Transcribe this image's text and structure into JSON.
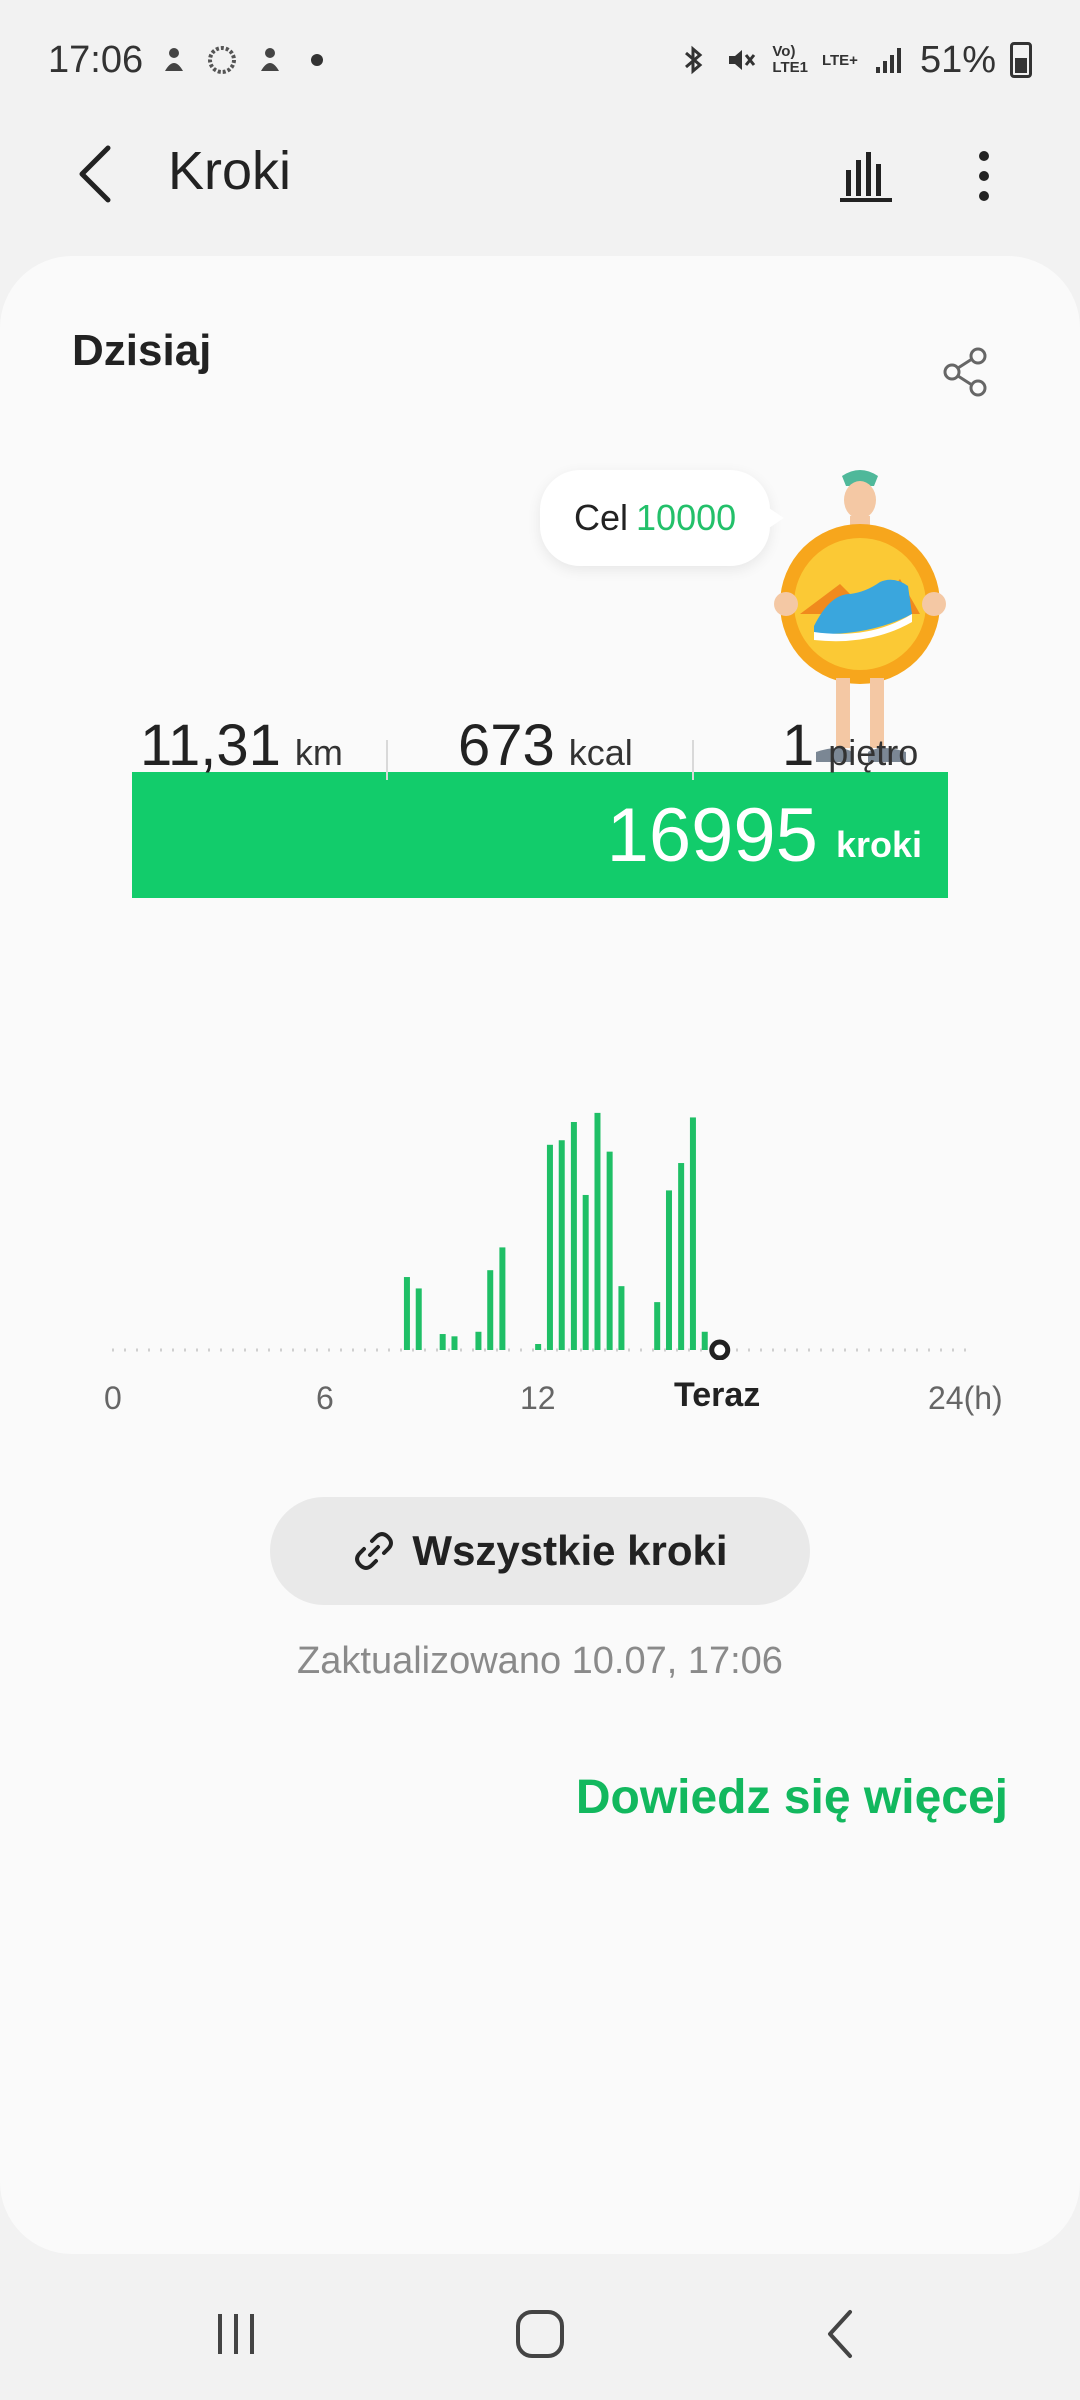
{
  "status_bar": {
    "time": "17:06",
    "network_top": "LTE+",
    "network_bottom": "LTE1",
    "volte": "Vo)",
    "battery": "51%",
    "icons": [
      "notification-icon",
      "sync-icon",
      "notification-icon",
      "bluetooth-icon",
      "mute-icon",
      "signal-icon",
      "battery-icon"
    ]
  },
  "app_bar": {
    "title": "Kroki",
    "icons": [
      "back-arrow-icon",
      "bar-chart-icon",
      "more-vert-icon"
    ]
  },
  "card": {
    "title": "Dzisiaj",
    "goal_label": "Cel",
    "goal_value": "10000",
    "steps_value": "16995",
    "steps_unit": "kroki",
    "stats": [
      {
        "value": "11,31",
        "unit": "km"
      },
      {
        "value": "673",
        "unit": "kcal"
      },
      {
        "value": "1",
        "unit": "piętro"
      }
    ],
    "all_steps_label": "Wszystkie kroki",
    "updated_text": "Zaktualizowano 10.07, 17:06",
    "learn_more": "Dowiedz się więcej"
  },
  "chart_data": {
    "type": "bar",
    "x_ticks": [
      "0",
      "6",
      "12",
      "Teraz",
      "24(h)"
    ],
    "x": [
      8.25,
      8.58,
      9.25,
      9.58,
      10.25,
      10.58,
      10.92,
      11.92,
      12.25,
      12.58,
      12.92,
      13.25,
      13.58,
      13.92,
      14.25,
      15.25,
      15.58,
      15.92,
      16.25,
      16.58
    ],
    "values": [
      0.32,
      0.27,
      0.07,
      0.06,
      0.08,
      0.35,
      0.45,
      0.02,
      0.9,
      0.92,
      1.0,
      0.68,
      1.04,
      0.87,
      0.28,
      0.21,
      0.7,
      0.82,
      1.02,
      0.08
    ],
    "now_hour": 17.0,
    "color": "#1fbf66"
  },
  "colors": {
    "accent": "#12cc6b",
    "link": "#12b85e",
    "background": "#f2f2f2",
    "card": "#fafafa"
  }
}
